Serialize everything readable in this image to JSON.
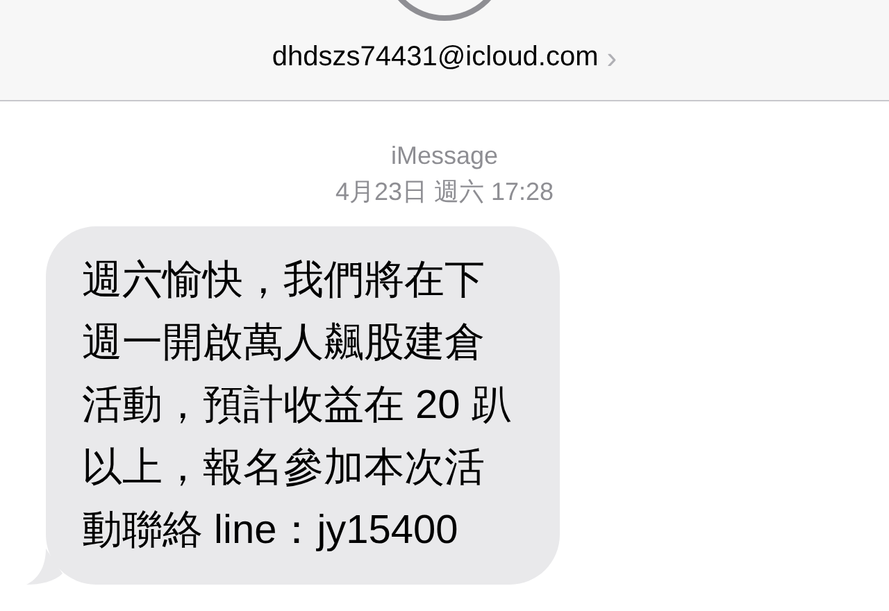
{
  "header": {
    "contact": "dhdszs74431@icloud.com",
    "chevron": "›"
  },
  "service_label": "iMessage",
  "timestamp": "4月23日 週六 17:28",
  "messages": [
    {
      "kind": "incoming",
      "text": "週六愉快，我們將在下週一開啟萬人飆股建倉活動，預計收益在 20 趴以上，報名參加本次活動聯絡 line：jy15400"
    }
  ]
}
